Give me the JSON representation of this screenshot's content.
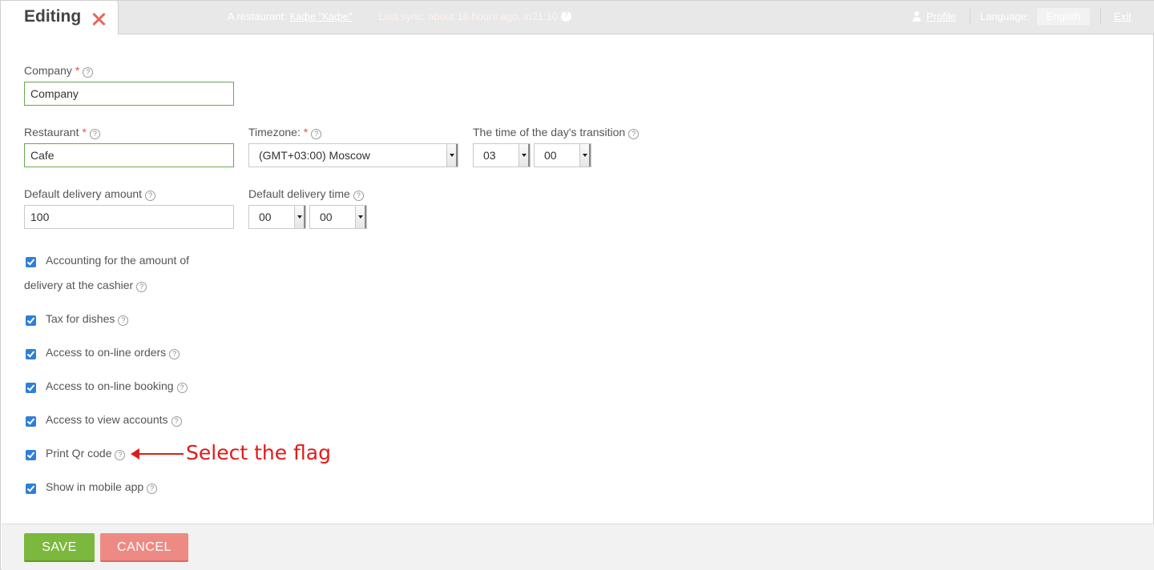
{
  "header": {
    "tab_title": "Editing",
    "restaurant_label": "A restaurant:",
    "restaurant_link": "Кафе \"Кафе\"",
    "sync_text": "Last sync: about 16 hours ago, in21:10",
    "profile_label": "Profile",
    "language_label": "Language:",
    "language_value": "English",
    "exit_label": "Exit"
  },
  "form": {
    "company": {
      "label": "Company",
      "value": "Company",
      "required": "*"
    },
    "restaurant": {
      "label": "Restaurant",
      "value": "Cafe",
      "required": "*"
    },
    "timezone": {
      "label": "Timezone:",
      "value": "(GMT+03:00) Moscow",
      "required": "*"
    },
    "day_transition": {
      "label": "The time of the day's transition",
      "hours": "03",
      "minutes": "00"
    },
    "delivery_amount": {
      "label": "Default delivery amount",
      "value": "100"
    },
    "delivery_time": {
      "label": "Default delivery time",
      "hours": "00",
      "minutes": "00"
    },
    "help_glyph": "?",
    "checkboxes": [
      {
        "label_line1": "Accounting for the amount of",
        "label_line2": "delivery at the cashier",
        "checked": true
      },
      {
        "label": "Tax for dishes",
        "checked": true
      },
      {
        "label": "Access to on-line orders",
        "checked": true
      },
      {
        "label": "Access to on-line booking",
        "checked": true
      },
      {
        "label": "Access to view accounts",
        "checked": true
      },
      {
        "label": "Print Qr code",
        "checked": true
      },
      {
        "label": "Show in mobile app",
        "checked": true
      }
    ]
  },
  "annotation": {
    "text": "Select the flag",
    "color": "#e01b1b"
  },
  "footer": {
    "save_label": "SAVE",
    "cancel_label": "CANCEL"
  },
  "colors": {
    "save": "#7cb83d",
    "cancel": "#ee8a84",
    "checkbox": "#2f7fd8",
    "valid_border": "#6aa84f"
  }
}
